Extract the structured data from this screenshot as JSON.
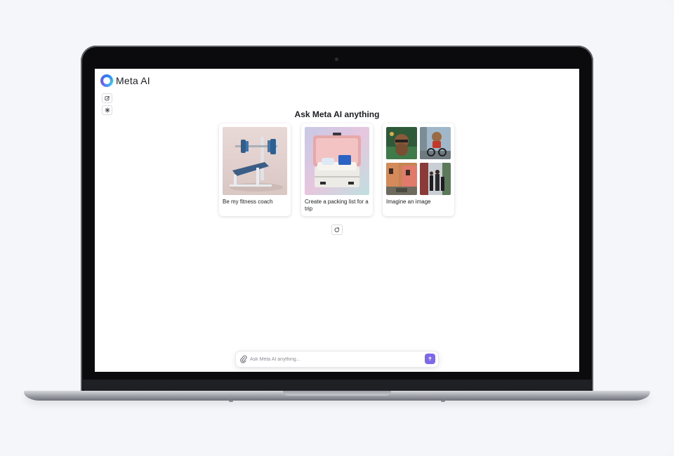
{
  "app": {
    "name": "Meta AI"
  },
  "main": {
    "headline": "Ask Meta AI anything"
  },
  "suggestions": [
    {
      "label": "Be my fitness coach",
      "image": "weight-bench-photo"
    },
    {
      "label": "Create a packing list for a trip",
      "image": "open-suitcase-photo"
    },
    {
      "label": "Imagine an image",
      "image": "imagined-images-grid"
    }
  ],
  "composer": {
    "placeholder": "Ask Meta AI anything..."
  },
  "icons": {
    "new_chat": "edit-icon",
    "discover": "sparkle-icon",
    "refresh": "refresh-icon",
    "attach": "paperclip-icon",
    "send": "send-arrow-icon"
  },
  "colors": {
    "accent": "#7b68ee",
    "logo_primary": "#2f7bf6",
    "logo_secondary": "#33c4f2"
  }
}
